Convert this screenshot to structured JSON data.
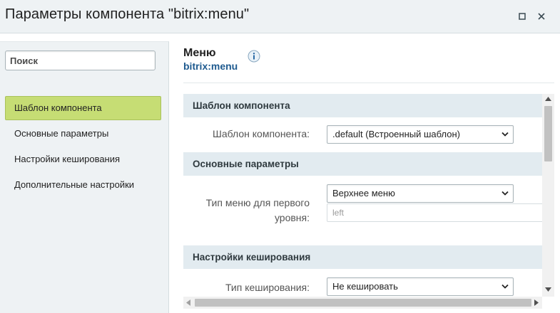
{
  "window": {
    "title": "Параметры компонента \"bitrix:menu\"",
    "controls": [
      "maximize-icon",
      "close-icon"
    ]
  },
  "sidebar": {
    "search_placeholder": "Поиск",
    "items": [
      {
        "label": "Шаблон компонента",
        "active": true
      },
      {
        "label": "Основные параметры",
        "active": false
      },
      {
        "label": "Настройки кеширования",
        "active": false
      },
      {
        "label": "Дополнительные настройки",
        "active": false
      }
    ]
  },
  "header": {
    "title": "Меню",
    "subtitle": "bitrix:menu",
    "info_icon": "info-icon"
  },
  "sections": [
    {
      "title": "Шаблон компонента",
      "fields": [
        {
          "label": "Шаблон компонента:",
          "value": ".default (Встроенный шаблон)"
        }
      ]
    },
    {
      "title": "Основные параметры",
      "fields": [
        {
          "label_line1": "Тип меню для первого",
          "label_line2": "уровня:",
          "value": "Верхнее меню",
          "extra_value": "left"
        }
      ]
    },
    {
      "title": "Настройки кеширования",
      "fields": [
        {
          "label": "Тип кеширования:",
          "value": "Не кешировать"
        }
      ]
    }
  ],
  "colors": {
    "active_nav": "#c6dd74",
    "section_header": "#e2ebf0",
    "subtitle_blue": "#1e5a8f",
    "panel_bg": "#eef2f4"
  }
}
